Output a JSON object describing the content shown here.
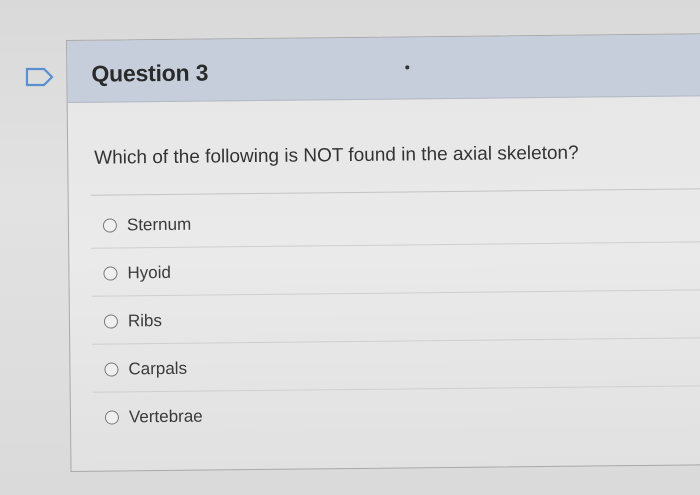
{
  "question": {
    "title": "Question 3",
    "prompt": "Which of the following is NOT found in the axial skeleton?",
    "options": [
      {
        "label": "Sternum"
      },
      {
        "label": "Hyoid"
      },
      {
        "label": "Ribs"
      },
      {
        "label": "Carpals"
      },
      {
        "label": "Vertebrae"
      }
    ]
  },
  "icons": {
    "flag": "flag-icon"
  }
}
